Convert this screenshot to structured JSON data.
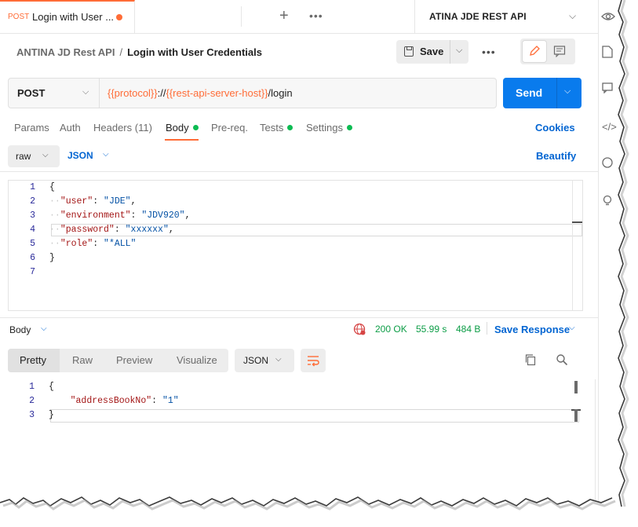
{
  "tabbar": {
    "active_tab": {
      "method": "POST",
      "title": "Login with User ...",
      "unsaved": true
    },
    "new_tab_icon": "plus-icon",
    "more_icon": "ellipsis-icon",
    "environment": "ATINA JDE REST API"
  },
  "header": {
    "breadcrumb_collection": "ANTINA JD Rest API",
    "breadcrumb_separator": "/",
    "breadcrumb_request": "Login with User Credentials",
    "save_label": "Save"
  },
  "request": {
    "method": "POST",
    "url_parts": [
      {
        "text": "{{protocol}}",
        "type": "var"
      },
      {
        "text": "://",
        "type": "plain"
      },
      {
        "text": "{{rest-api-server-host}}",
        "type": "var"
      },
      {
        "text": "/login",
        "type": "plain"
      }
    ],
    "send_label": "Send"
  },
  "request_tabs": [
    {
      "label": "Params",
      "dot": false,
      "active": false
    },
    {
      "label": "Auth",
      "dot": false,
      "active": false
    },
    {
      "label": "Headers (11)",
      "dot": false,
      "active": false
    },
    {
      "label": "Body",
      "dot": true,
      "active": true
    },
    {
      "label": "Pre-req.",
      "dot": false,
      "active": false
    },
    {
      "label": "Tests",
      "dot": true,
      "active": false
    },
    {
      "label": "Settings",
      "dot": true,
      "active": false
    }
  ],
  "cookies_label": "Cookies",
  "body_options": {
    "mode": "raw",
    "language": "JSON",
    "beautify_label": "Beautify"
  },
  "request_body": [
    {
      "n": "1",
      "tokens": [
        {
          "t": "{",
          "c": "p"
        }
      ]
    },
    {
      "n": "2",
      "tokens": [
        {
          "t": "··",
          "c": "ws"
        },
        {
          "t": "\"user\"",
          "c": "k"
        },
        {
          "t": ": ",
          "c": "p"
        },
        {
          "t": "\"JDE\"",
          "c": "s"
        },
        {
          "t": ",",
          "c": "p"
        }
      ]
    },
    {
      "n": "3",
      "tokens": [
        {
          "t": "··",
          "c": "ws"
        },
        {
          "t": "\"environment\"",
          "c": "k"
        },
        {
          "t": ": ",
          "c": "p"
        },
        {
          "t": "\"JDV920\"",
          "c": "s"
        },
        {
          "t": ",",
          "c": "p"
        }
      ]
    },
    {
      "n": "4",
      "tokens": [
        {
          "t": "··",
          "c": "ws"
        },
        {
          "t": "\"password\"",
          "c": "k"
        },
        {
          "t": ": ",
          "c": "p"
        },
        {
          "t": "\"xxxxxx\"",
          "c": "s"
        },
        {
          "t": ",",
          "c": "p"
        }
      ]
    },
    {
      "n": "5",
      "tokens": [
        {
          "t": "··",
          "c": "ws"
        },
        {
          "t": "\"role\"",
          "c": "k"
        },
        {
          "t": ": ",
          "c": "p"
        },
        {
          "t": "\"*ALL\"",
          "c": "s"
        }
      ]
    },
    {
      "n": "6",
      "tokens": [
        {
          "t": "}",
          "c": "p"
        }
      ]
    },
    {
      "n": "7",
      "tokens": []
    }
  ],
  "response": {
    "section_label": "Body",
    "status": "200 OK",
    "time": "55.99 s",
    "size": "484 B",
    "save_response_label": "Save Response",
    "view_tabs": [
      "Pretty",
      "Raw",
      "Preview",
      "Visualize"
    ],
    "active_view": "Pretty",
    "format": "JSON",
    "body": [
      {
        "n": "1",
        "tokens": [
          {
            "t": "{",
            "c": "p"
          }
        ]
      },
      {
        "n": "2",
        "tokens": [
          {
            "t": "    ",
            "c": "p"
          },
          {
            "t": "\"addressBookNo\"",
            "c": "k"
          },
          {
            "t": ": ",
            "c": "p"
          },
          {
            "t": "\"1\"",
            "c": "s"
          }
        ]
      },
      {
        "n": "3",
        "tokens": [
          {
            "t": "}",
            "c": "p"
          }
        ]
      }
    ]
  },
  "colors": {
    "accent": "#ff6c37",
    "send": "#097bed",
    "link": "#0265d2",
    "success": "#0c9d46",
    "dot": "#0cbb52"
  }
}
